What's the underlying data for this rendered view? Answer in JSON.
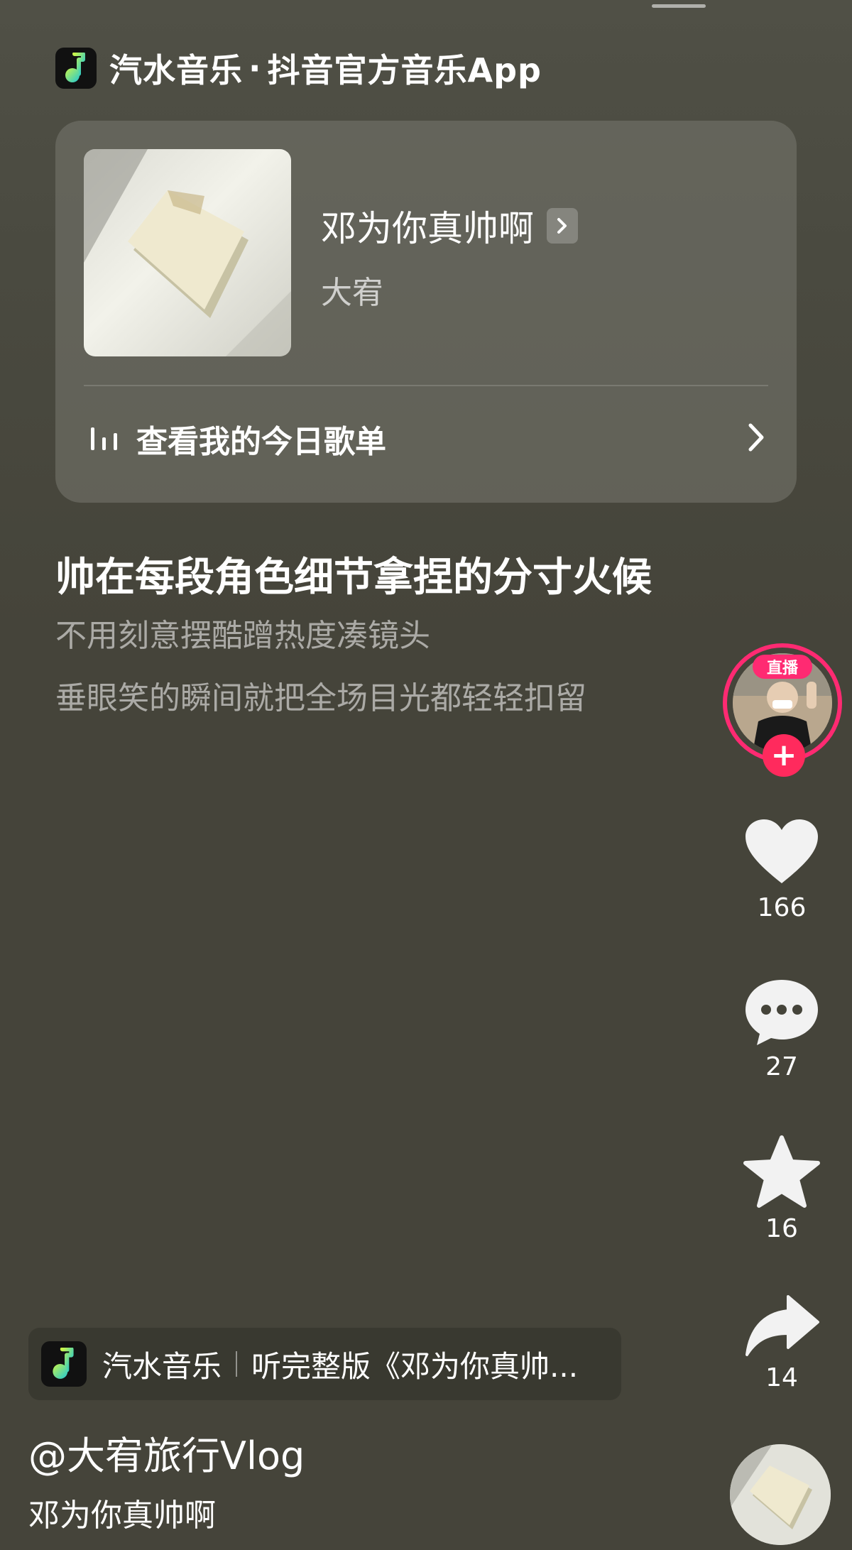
{
  "header": {
    "app_name": "汽水音乐",
    "separator": "·",
    "tagline": "抖音官方音乐App"
  },
  "song_card": {
    "title": "邓为你真帅啊",
    "artist": "大宥",
    "playlist_label": "查看我的今日歌单"
  },
  "lyrics": {
    "main": "帅在每段角色细节拿捏的分寸火候",
    "sub1": "不用刻意摆酷蹭热度凑镜头",
    "sub2": "垂眼笑的瞬间就把全场目光都轻轻扣留"
  },
  "sidebar": {
    "live_badge": "直播",
    "follow": "+",
    "likes": "166",
    "comments": "27",
    "favorites": "16",
    "shares": "14"
  },
  "music_bar": {
    "app_name": "汽水音乐",
    "cta": "听完整版《邓为你真帅..."
  },
  "post": {
    "author": "@大宥旅行Vlog",
    "caption": "邓为你真帅啊"
  },
  "colors": {
    "background": "#45443a",
    "live_pink": "#ff2a72",
    "logo_green": "#2bd46b"
  },
  "icons": [
    "soda-music-logo-icon",
    "chevron-right-icon",
    "bars-icon",
    "heart-icon",
    "comment-icon",
    "star-icon",
    "share-icon"
  ]
}
